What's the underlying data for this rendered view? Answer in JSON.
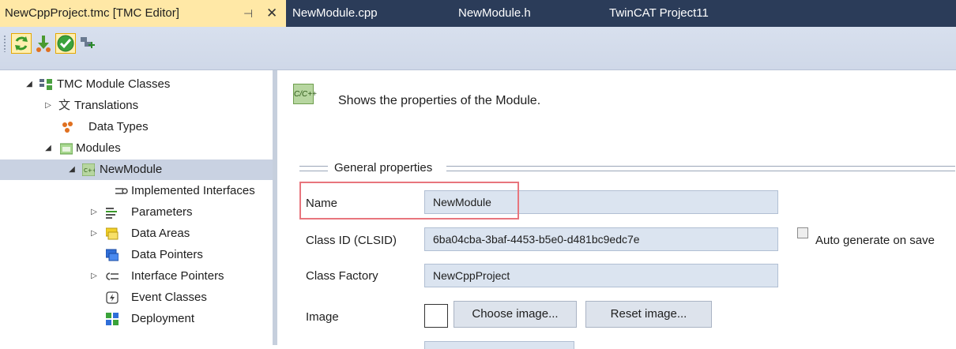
{
  "tabs": [
    {
      "label": "NewCppProject.tmc [TMC Editor]",
      "active": true
    },
    {
      "label": "NewModule.cpp",
      "active": false
    },
    {
      "label": "NewModule.h",
      "active": false
    },
    {
      "label": "TwinCAT Project11",
      "active": false
    }
  ],
  "tab_controls": {
    "pin": "⊣",
    "close": "✕"
  },
  "toolbar": {
    "buttons": [
      "refresh-icon",
      "update-transfer-icon",
      "check-icon",
      "add-module-icon"
    ]
  },
  "tree": {
    "root": {
      "label": "TMC Module Classes",
      "expanded": true
    },
    "translations": {
      "label": "Translations"
    },
    "data_types": {
      "label": "Data Types"
    },
    "modules": {
      "label": "Modules",
      "expanded": true
    },
    "new_module": {
      "label": "NewModule",
      "selected": true,
      "expanded": true
    },
    "children": {
      "implemented_interfaces": "Implemented Interfaces",
      "parameters": "Parameters",
      "data_areas": "Data Areas",
      "data_pointers": "Data Pointers",
      "interface_pointers": "Interface Pointers",
      "event_classes": "Event Classes",
      "deployment": "Deployment"
    }
  },
  "panel": {
    "icon_text": "C/C++",
    "description": "Shows the properties of the Module.",
    "group_title": "General properties",
    "name_label": "Name",
    "name_value": "NewModule",
    "class_id_label": "Class ID (CLSID)",
    "class_id_value": "6ba04cba-3baf-4453-b5e0-d481bc9edc7e",
    "auto_generate_label": "Auto generate on save",
    "auto_generate_checked": false,
    "class_factory_label": "Class Factory",
    "class_factory_value": "NewCppProject",
    "image_label": "Image",
    "choose_image_button": "Choose image...",
    "reset_image_button": "Reset image..."
  },
  "colors": {
    "tabbar_bg": "#2b3c59",
    "active_tab_bg": "#ffe8a6",
    "toolbar_bg": "#d3dceb",
    "selected_row_bg": "#c9d2e2",
    "field_bg": "#dbe4f0",
    "highlight": "#e8757d"
  }
}
